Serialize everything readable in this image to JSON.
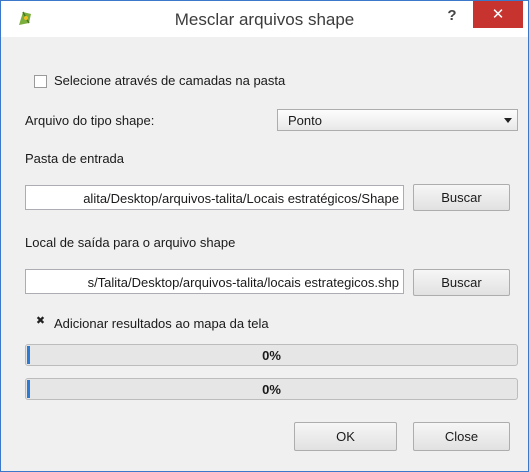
{
  "window": {
    "title": "Mesclar arquivos shape",
    "help_label": "?",
    "close_label": "✕"
  },
  "form": {
    "select_from_layers_label": "Selecione através de camadas na pasta",
    "select_from_layers_checked": false,
    "shape_type_label": "Arquivo do tipo shape:",
    "shape_type_value": "Ponto",
    "input_folder_label": "Pasta de entrada",
    "input_folder_value": "alita/Desktop/arquivos-talita/Locais estratégicos/Shape",
    "browse_input_label": "Buscar",
    "output_label": "Local de saída para o arquivo shape",
    "output_value": "s/Talita/Desktop/arquivos-talita/locais estrategicos.shp",
    "browse_output_label": "Buscar",
    "add_results_label": "Adicionar resultados ao mapa da tela",
    "add_results_checked": true,
    "add_results_mark": "✖"
  },
  "progress": {
    "bar1_text": "0%",
    "bar1_value": 0,
    "bar2_text": "0%",
    "bar2_value": 0
  },
  "buttons": {
    "ok_label": "OK",
    "close_label": "Close"
  },
  "colors": {
    "accent": "#2a7ad6",
    "close_button": "#c7332f",
    "window_border": "#3b78c9"
  }
}
